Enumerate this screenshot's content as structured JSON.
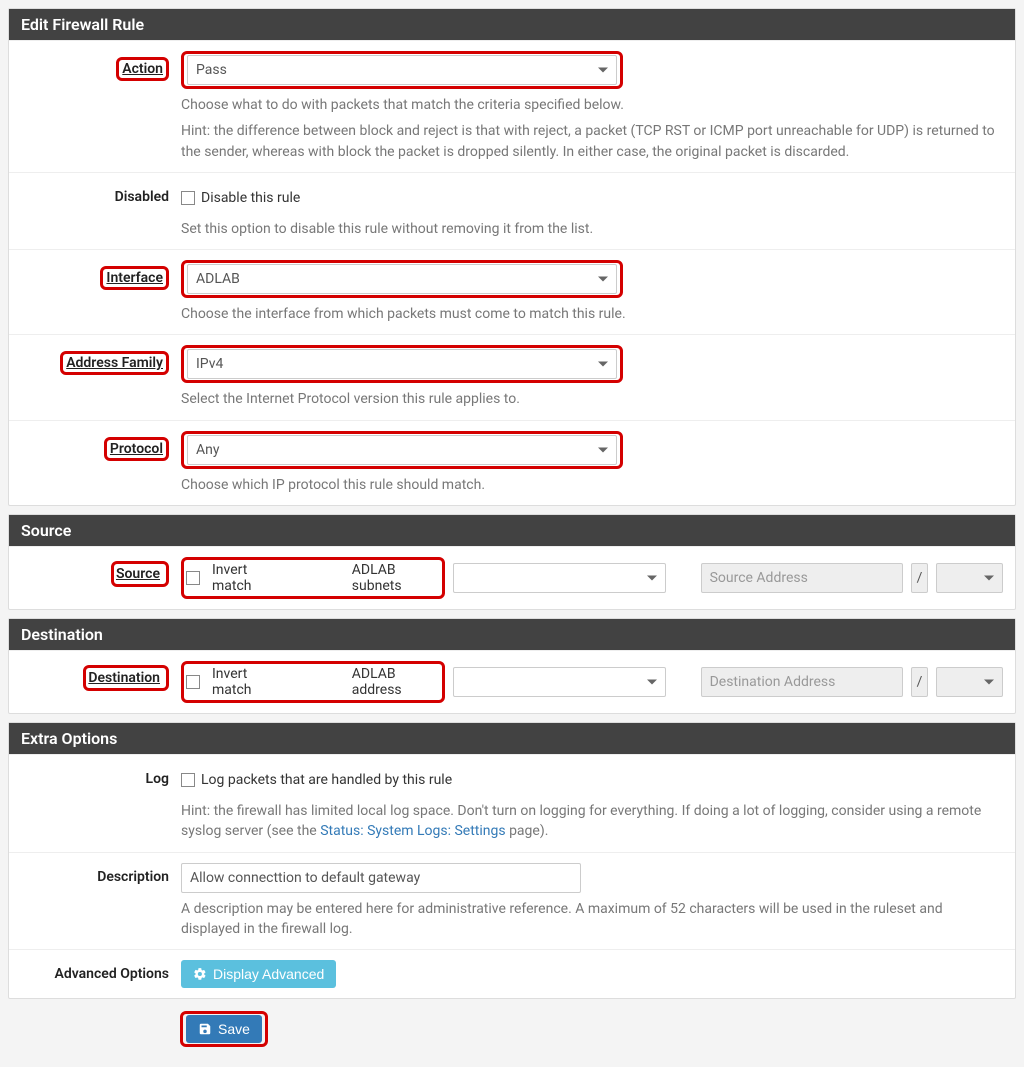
{
  "panels": {
    "edit": "Edit Firewall Rule",
    "source": "Source",
    "destination": "Destination",
    "extra": "Extra Options"
  },
  "action": {
    "label": "Action",
    "value": "Pass",
    "help1": "Choose what to do with packets that match the criteria specified below.",
    "help2": "Hint: the difference between block and reject is that with reject, a packet (TCP RST or ICMP port unreachable for UDP) is returned to the sender, whereas with block the packet is dropped silently. In either case, the original packet is discarded."
  },
  "disabled": {
    "label": "Disabled",
    "cb_label": "Disable this rule",
    "help": "Set this option to disable this rule without removing it from the list."
  },
  "interface": {
    "label": "Interface",
    "value": "ADLAB",
    "help": "Choose the interface from which packets must come to match this rule."
  },
  "address_family": {
    "label": "Address Family",
    "value": "IPv4",
    "help": "Select the Internet Protocol version this rule applies to."
  },
  "protocol": {
    "label": "Protocol",
    "value": "Any",
    "help": "Choose which IP protocol this rule should match."
  },
  "source": {
    "label": "Source",
    "invert_label": "Invert match",
    "net_value": "ADLAB subnets",
    "addr_placeholder": "Source Address",
    "slash": "/"
  },
  "destination": {
    "label": "Destination",
    "invert_label": "Invert match",
    "net_value": "ADLAB address",
    "addr_placeholder": "Destination Address",
    "slash": "/"
  },
  "log": {
    "label": "Log",
    "cb_label": "Log packets that are handled by this rule",
    "help_pre": "Hint: the firewall has limited local log space. Don't turn on logging for everything. If doing a lot of logging, consider using a remote syslog server (see the ",
    "help_link": "Status: System Logs: Settings",
    "help_post": " page)."
  },
  "description": {
    "label": "Description",
    "value": "Allow connecttion to default gateway",
    "help": "A description may be entered here for administrative reference. A maximum of 52 characters will be used in the ruleset and displayed in the firewall log."
  },
  "advanced": {
    "label": "Advanced Options",
    "button": "Display Advanced"
  },
  "save": {
    "label": "Save"
  }
}
